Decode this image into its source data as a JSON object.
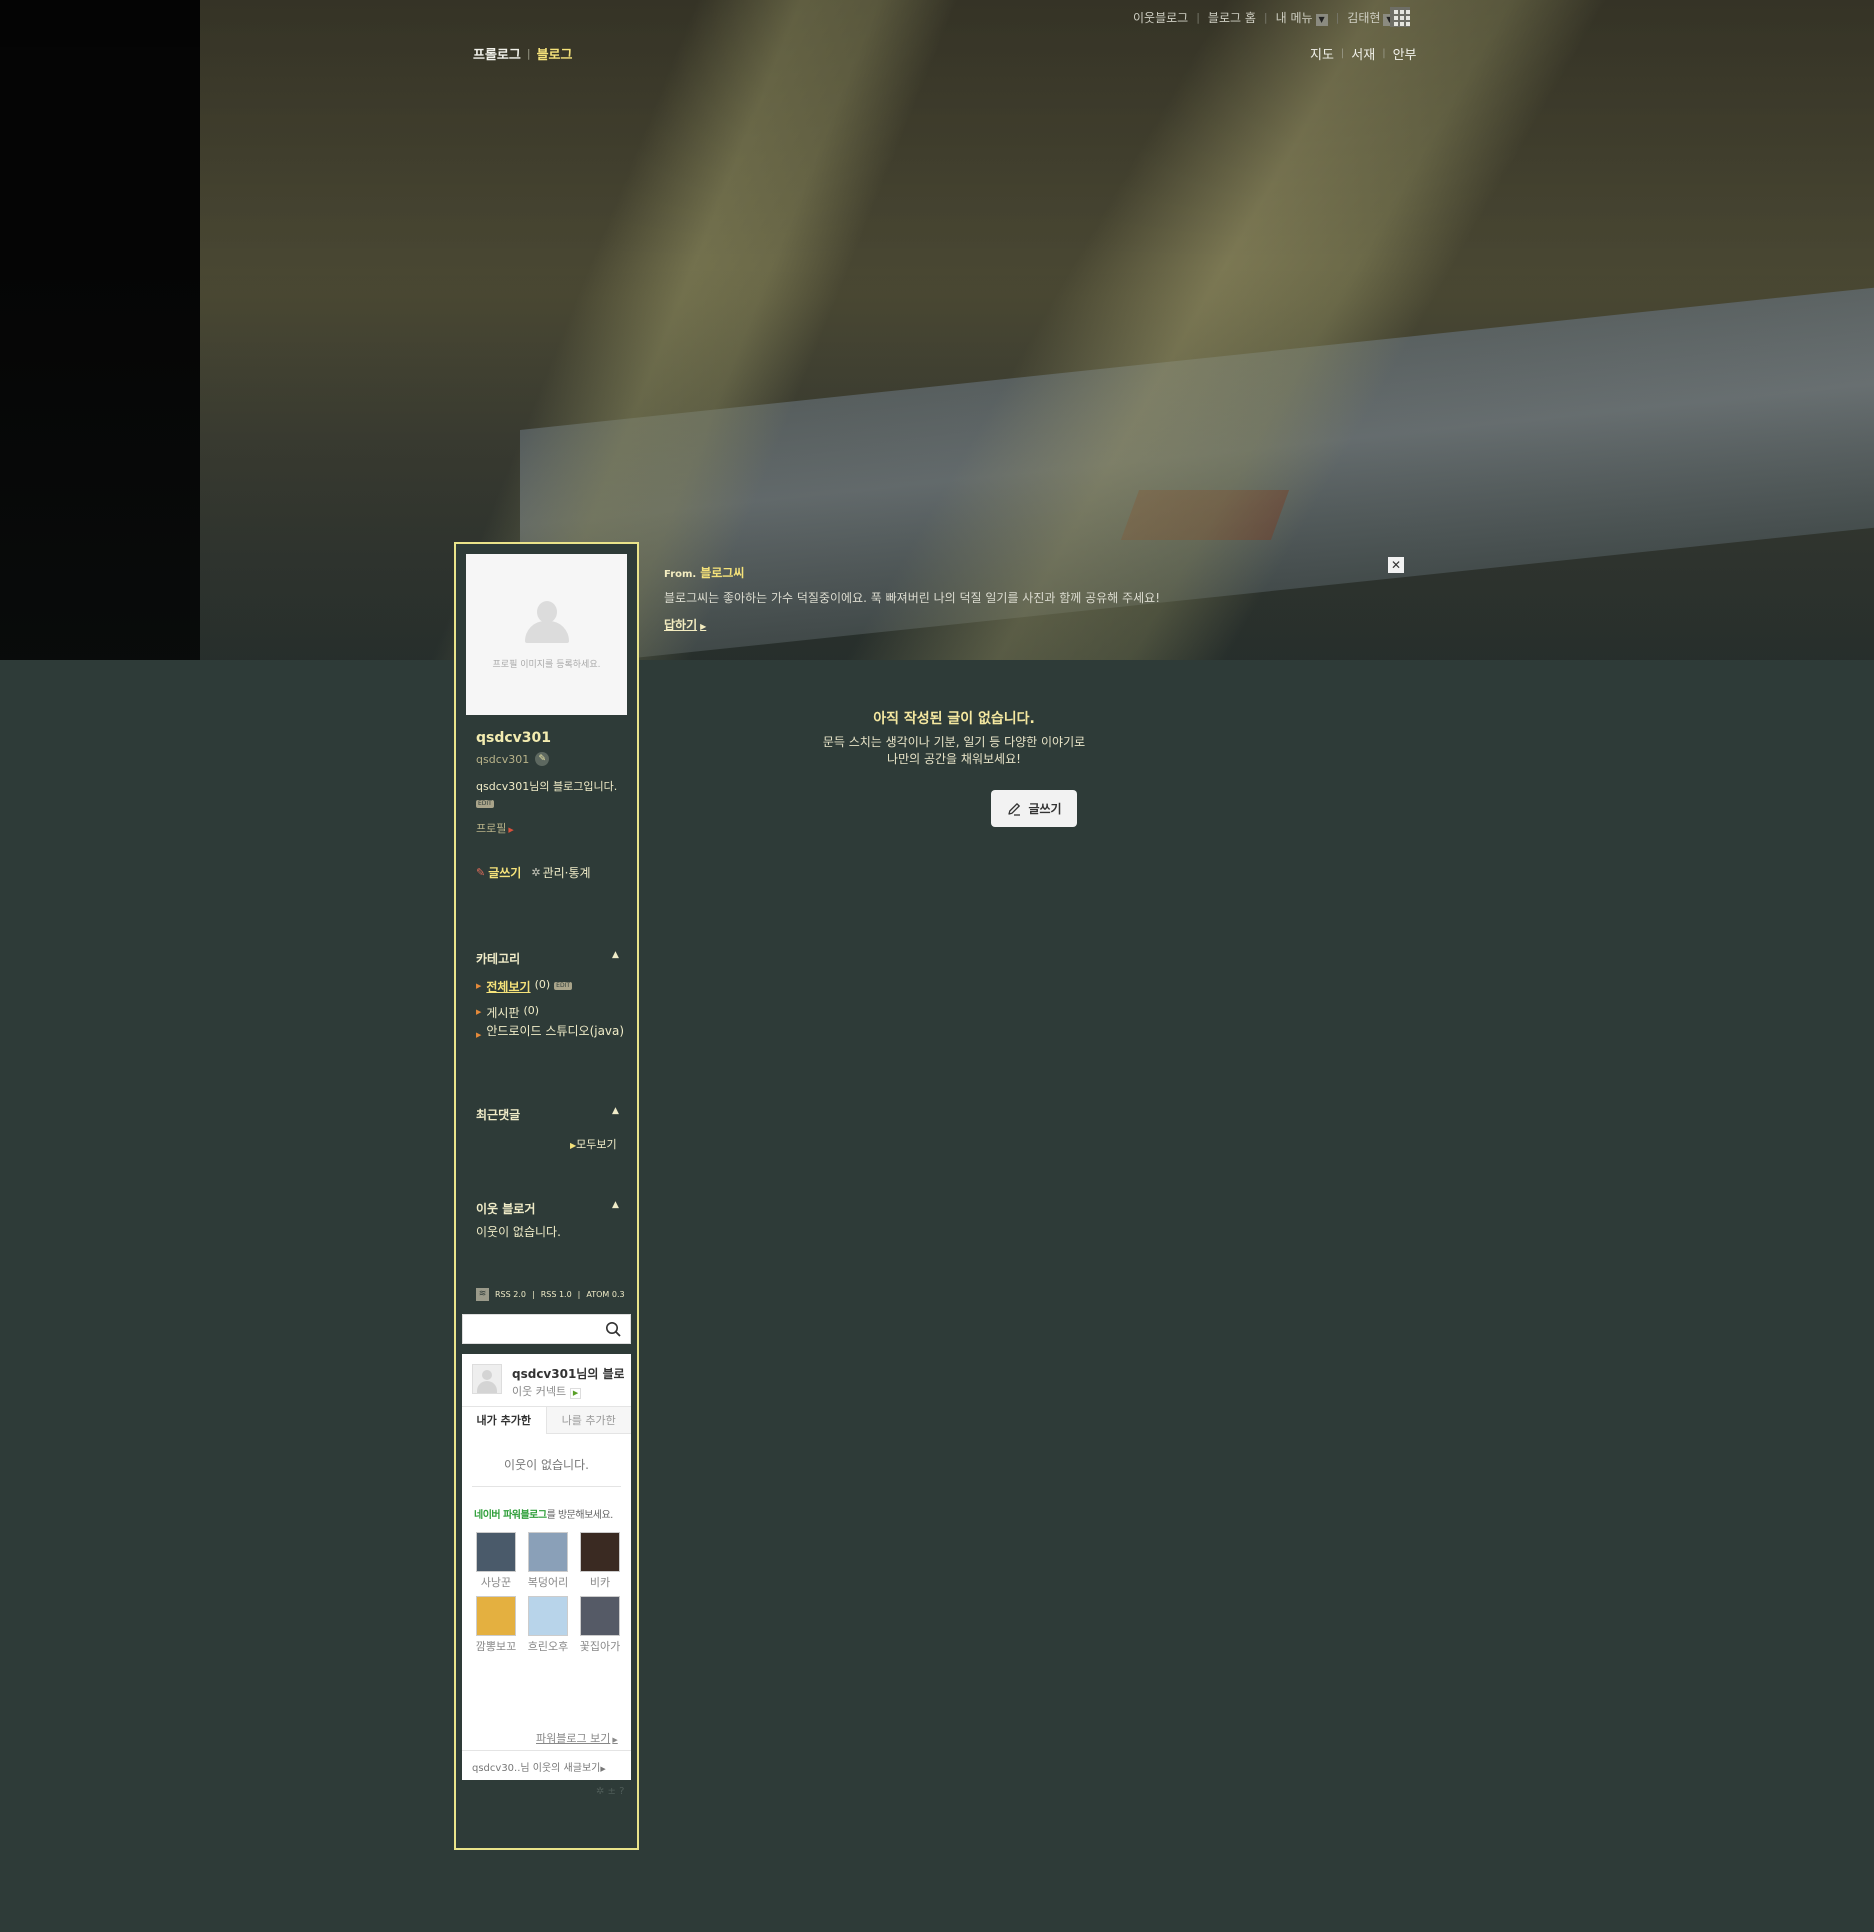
{
  "gnb": {
    "neighbor_blog": "이웃블로그",
    "blog_home": "블로그 홈",
    "my_menu": "내 메뉴",
    "user_name": "김태현",
    "apps_icon": "grid-icon"
  },
  "blog_nav": {
    "prologue": "프롤로그",
    "blog": "블로그",
    "map": "지도",
    "library": "서재",
    "guestbook": "안부"
  },
  "notice": {
    "from_label": "From.",
    "from_name": "블로그씨",
    "message": "블로그씨는 좋아하는 가수 덕질중이에요. 푹 빠져버린 나의 덕질 일기를 사진과 함께 공유해 주세요!",
    "reply": "답하기",
    "close": "✕"
  },
  "profile": {
    "image_hint": "프로필 이미지를 등록하세요.",
    "nickname": "qsdcv301",
    "user_id": "qsdcv301",
    "intro": "qsdcv301님의 블로그입니다.",
    "edit_tag": "EDIT",
    "profile_link": "프로필"
  },
  "actions": {
    "write": "글쓰기",
    "manage": "관리·통계"
  },
  "category": {
    "title": "카테고리",
    "items": [
      {
        "label": "전체보기",
        "count": "(0)"
      },
      {
        "label": "게시판",
        "count": "(0)"
      },
      {
        "label": "안드로이드 스튜디오(java)",
        "count": ""
      }
    ]
  },
  "recent_comments": {
    "title": "최근댓글",
    "see_all": "모두보기"
  },
  "neighbor_bloggers": {
    "title": "이웃 블로거",
    "empty": "이웃이 없습니다."
  },
  "rss": {
    "rss20": "RSS 2.0",
    "rss10": "RSS 1.0",
    "atom": "ATOM 0.3"
  },
  "search": {
    "placeholder": ""
  },
  "buddy_widget": {
    "title": "qsdcv301님의 블로그",
    "connect": "이웃 커넥트",
    "tab_mine": "내가 추가한",
    "tab_others": "나를 추가한",
    "empty": "이웃이 없습니다.",
    "power_brand": "네이버 파워블로그",
    "power_suffix": "를 방문해보세요.",
    "power_blogs": [
      {
        "name": "사낭꾼",
        "color": "#4a5a6a"
      },
      {
        "name": "복덩어리",
        "color": "#8aa0b8"
      },
      {
        "name": "비카",
        "color": "#3a2a22"
      },
      {
        "name": "깜뽕보꼬",
        "color": "#e4b040"
      },
      {
        "name": "흐린오후",
        "color": "#b8d4ea"
      },
      {
        "name": "꽃집아가",
        "color": "#555a66"
      }
    ],
    "more": "파워블로그 보기",
    "footer": "qsdcv30..님 이웃의 새글보기"
  },
  "main": {
    "empty_title": "아직 작성된 글이 없습니다.",
    "empty_line1": "문득 스치는 생각이나 기분, 일기 등 다양한 이야기로",
    "empty_line2": "나만의 공간을 채워보세요!",
    "write_button": "글쓰기"
  }
}
